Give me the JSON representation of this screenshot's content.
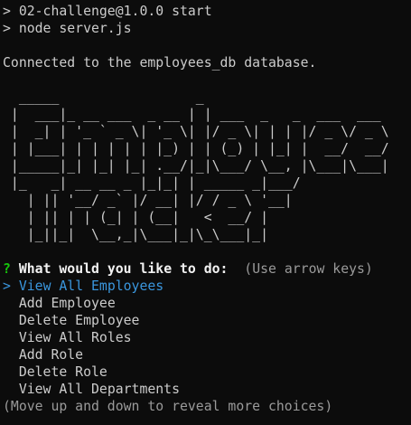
{
  "terminal": {
    "lines": [
      "> 02-challenge@1.0.0 start",
      "> node server.js"
    ],
    "connected_message": "Connected to the employees_db database.",
    "ascii_art": "  _____                 _\n |  ___|_ __ ___  _ __ | | ___  _   _  ___  ___\n |  _| | '_ ` _ \\| '_ \\| |/ _ \\| | | |/ _ \\/ _ \\\n | |___| | | | | | |_) | | (_) | |_| |  __/  __/\n |_____|_| |_| |_| .__/|_|\\___/ \\__, |\\___|\\___|\n |_   _| __ __ _ |_|_| | _____ _|___/\n   | || '__/ _` |/ __| |/ / _ \\ '__|\n   | || | | (_| | (__|   <  __/ |\n   |_||_|  \\__,_|\\___|_|\\_\\___|_|",
    "prompt": {
      "mark": "?",
      "question": "What would you like to do:",
      "hint": "(Use arrow keys)"
    },
    "choices": [
      "View All Employees",
      "Add Employee",
      "Delete Employee",
      "View All Roles",
      "Add Role",
      "Delete Role",
      "View All Departments"
    ],
    "selected_pointer": ">",
    "footer_hint": "(Move up and down to reveal more choices)"
  },
  "colors": {
    "background": "#0c0c0c",
    "text": "#cccccc",
    "prompt_mark": "#16c60c",
    "selected": "#3a96dd",
    "hint": "#9a9a9a"
  }
}
